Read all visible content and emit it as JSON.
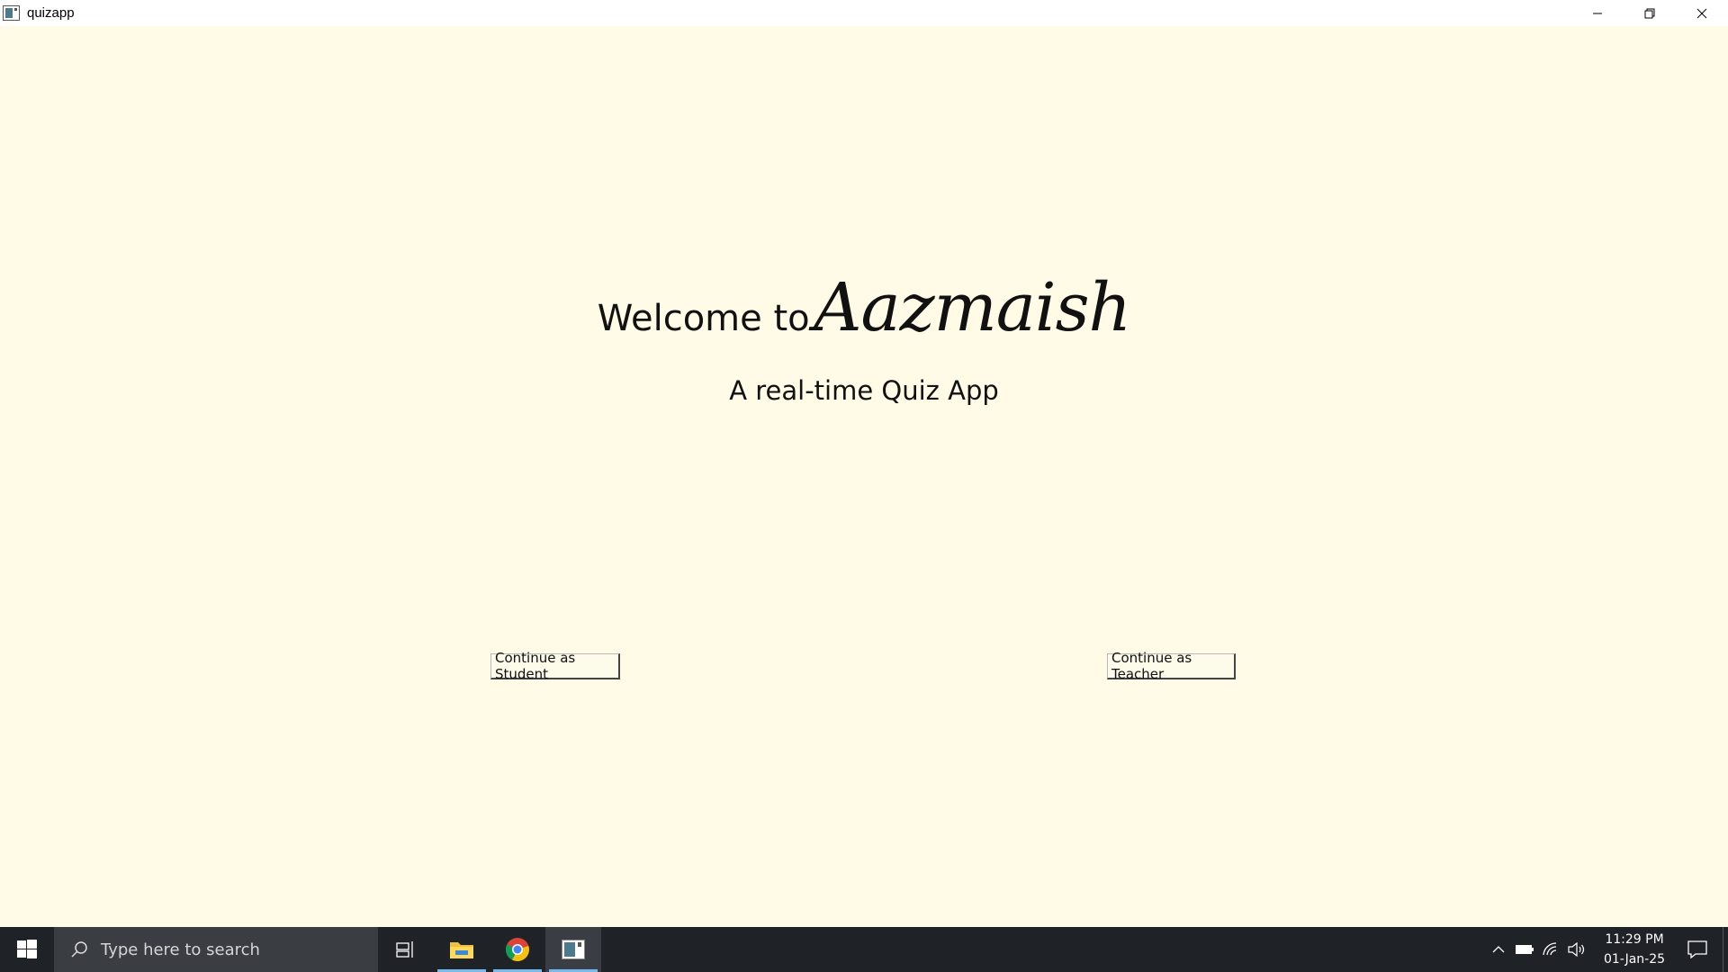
{
  "window": {
    "title": "quizapp",
    "controls": [
      "minimize-icon",
      "restore-icon",
      "close-icon"
    ]
  },
  "main": {
    "welcome_prefix": "Welcome to",
    "brand": "Aazmaish",
    "subtitle": "A real-time Quiz App",
    "student_button": "Continue as Student",
    "teacher_button": "Continue as Teacher"
  },
  "taskbar": {
    "search_placeholder": "Type here to search",
    "apps": [
      "task-view-icon",
      "file-explorer-icon",
      "chrome-icon",
      "quizapp-icon"
    ],
    "tray_icons": [
      "chevron-up-icon",
      "battery-icon",
      "wifi-icon",
      "volume-icon"
    ],
    "time": "11:29 PM",
    "date": "01-Jan-25"
  },
  "colors": {
    "background": "#fffbe6",
    "taskbar": "#1f2226",
    "accent": "#76b9ed"
  }
}
